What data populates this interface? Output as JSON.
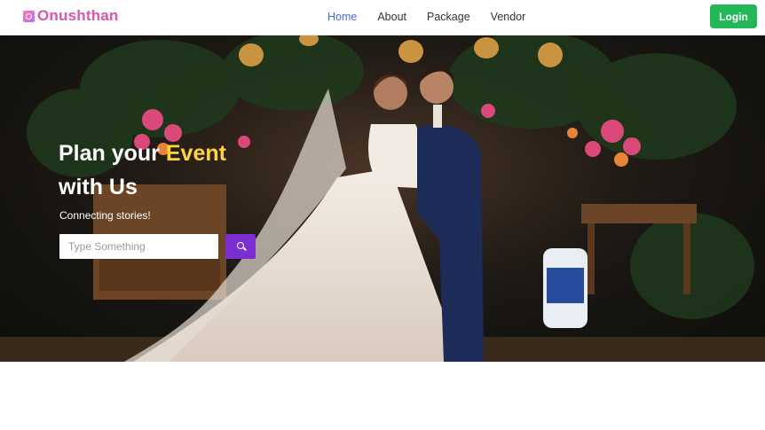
{
  "brand": {
    "name": "Onushthan",
    "icon": "logo-icon"
  },
  "nav": {
    "items": [
      {
        "label": "Home",
        "active": true
      },
      {
        "label": "About",
        "active": false
      },
      {
        "label": "Package",
        "active": false
      },
      {
        "label": "Vendor",
        "active": false
      }
    ],
    "login_label": "Login"
  },
  "hero": {
    "title_part1": "Plan your ",
    "title_highlight": "Event",
    "title_part2": "with Us",
    "subtitle": "Connecting stories!",
    "search": {
      "placeholder": "Type Something",
      "value": "",
      "icon": "search-icon"
    }
  },
  "colors": {
    "accent": "#3f6fd6",
    "login": "#22b857",
    "search_button": "#7b2fd0",
    "highlight": "#ffd43b",
    "brand": "#d65fb0"
  }
}
